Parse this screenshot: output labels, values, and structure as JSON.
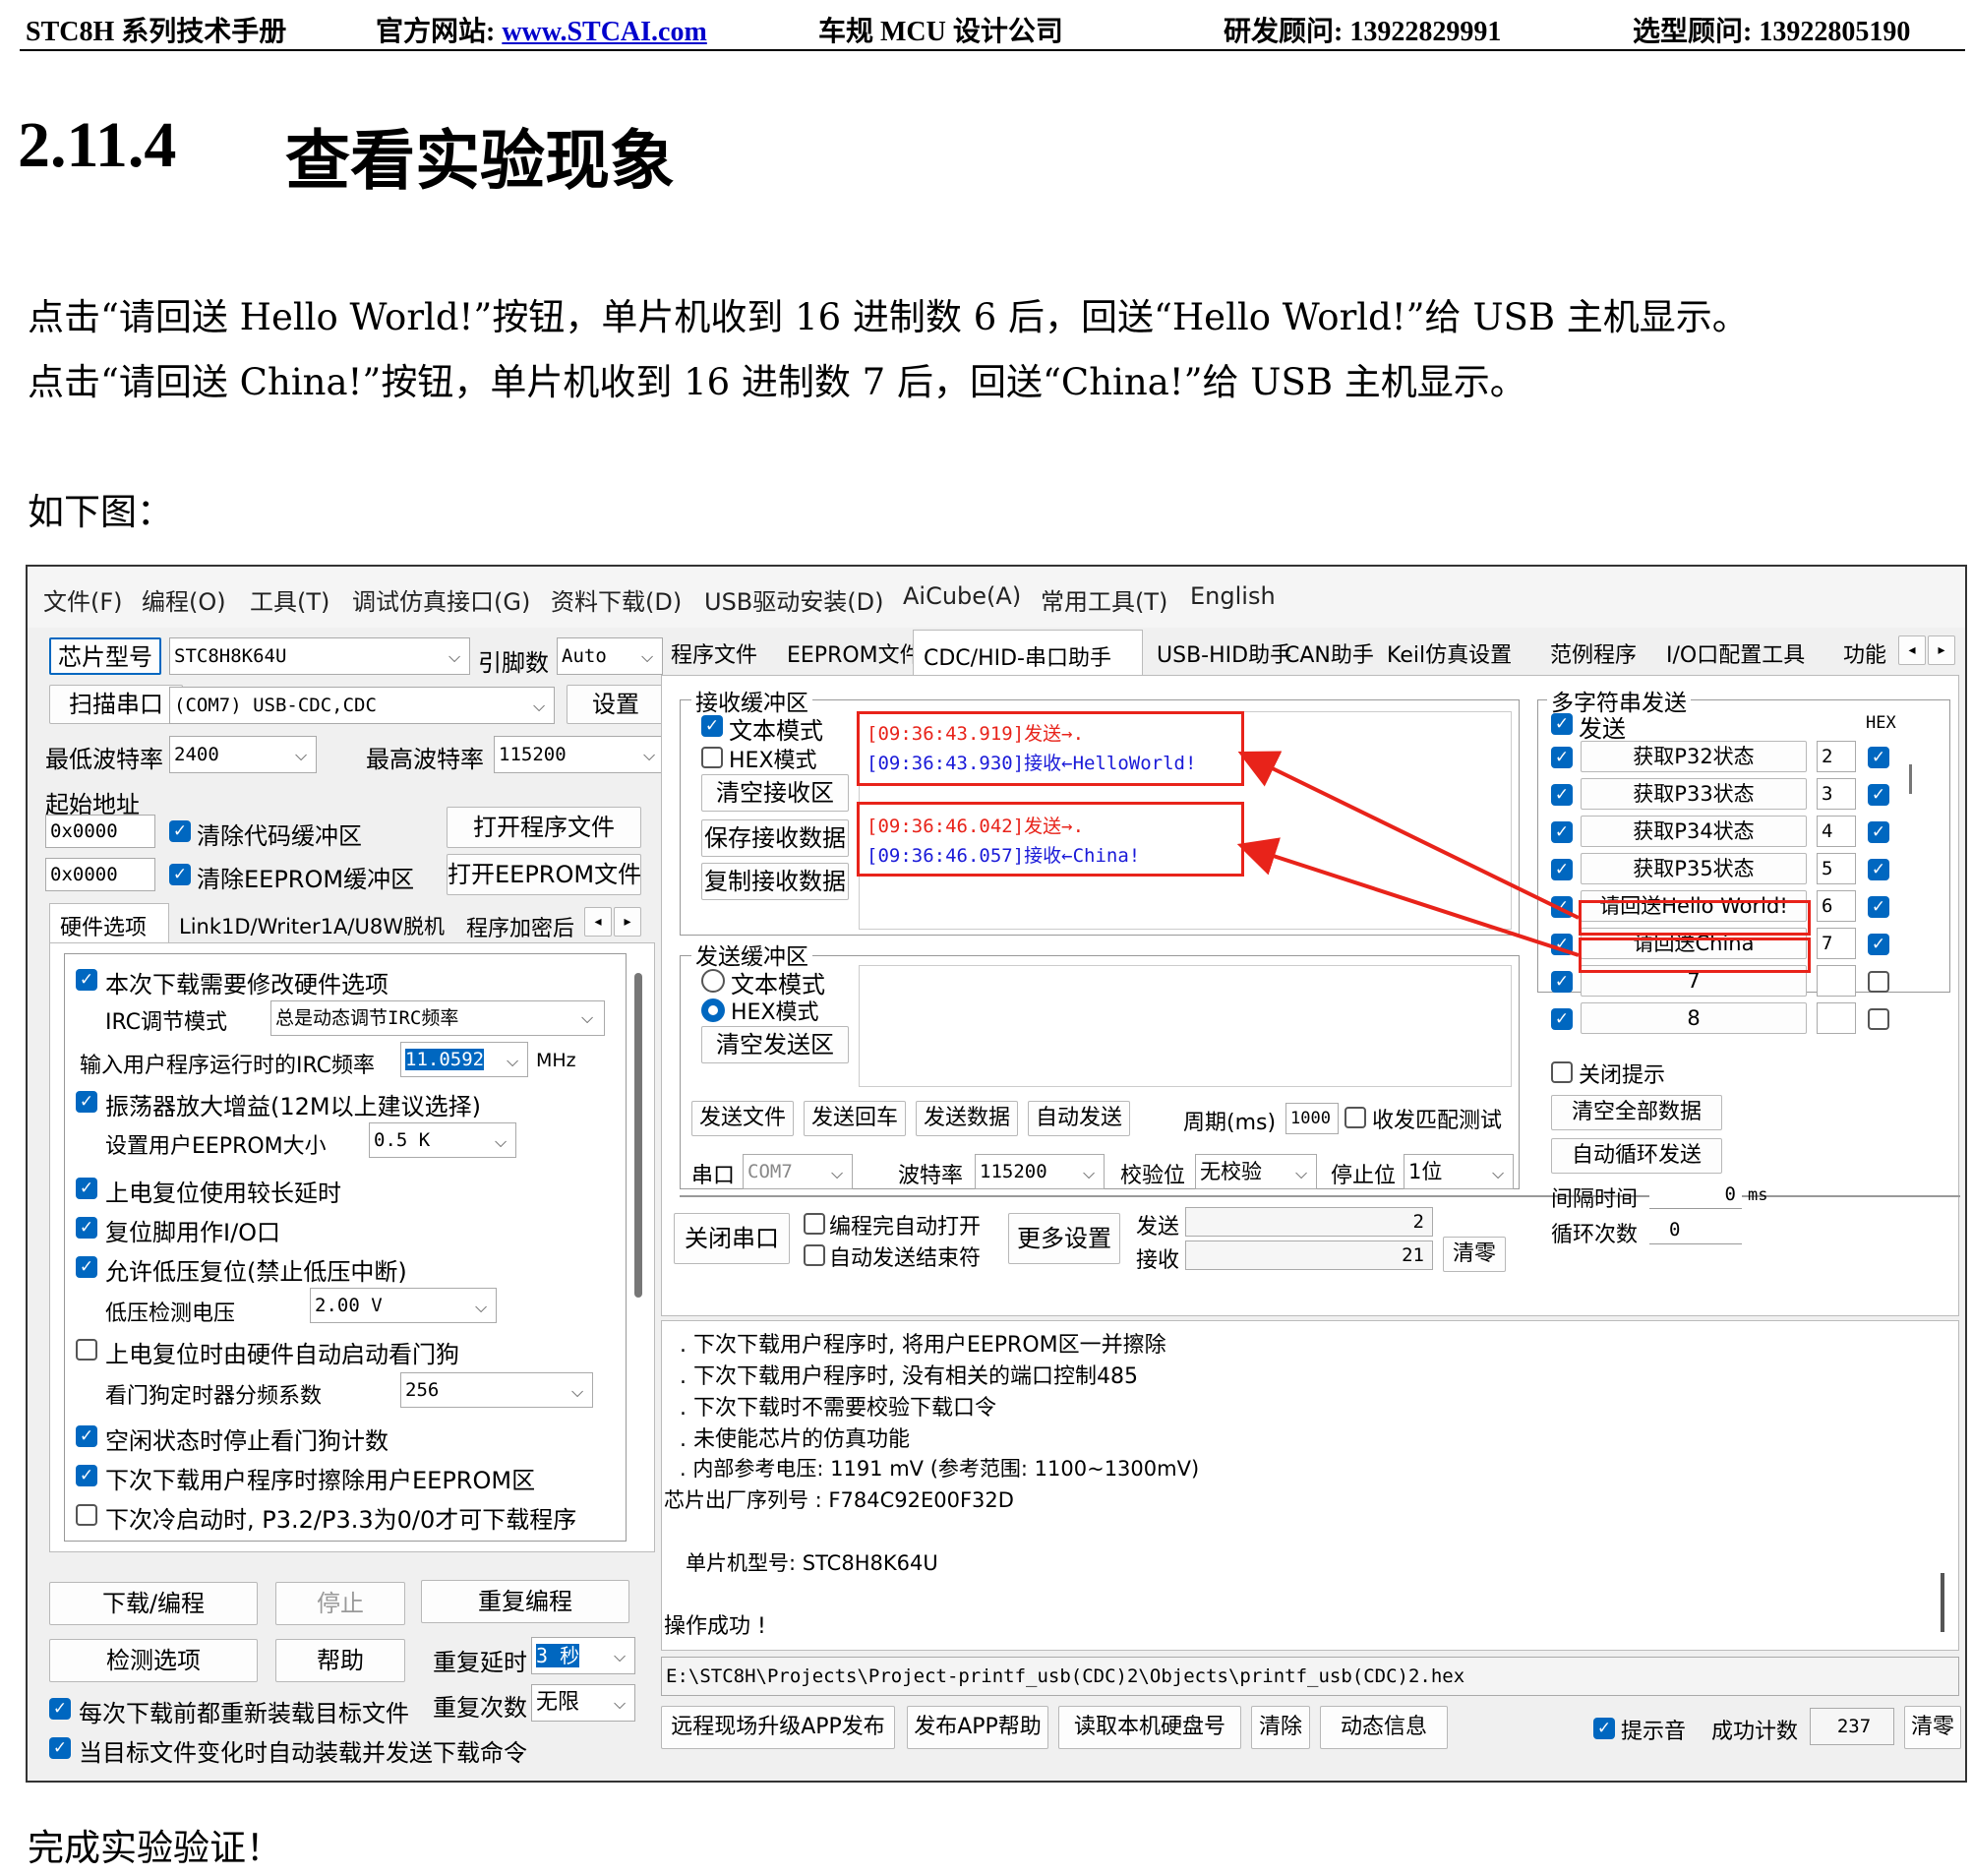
{
  "header": {
    "manual": "STC8H 系列技术手册",
    "site_label": "官方网站: ",
    "site_link": "www.STCAI.com",
    "company": "车规 MCU 设计公司",
    "rd": "研发顾问: 13922829991",
    "sel": "选型顾问: 13922805190"
  },
  "section": {
    "number": "2.11.4",
    "title": "查看实验现象"
  },
  "paragraphs": {
    "p1": "点击“请回送 Hello World!”按钮，单片机收到 16 进制数 6 后，回送“Hello World!”给 USB 主机显示。",
    "p2": "点击“请回送 China!”按钮，单片机收到 16 进制数 7 后，回送“China!”给 USB 主机显示。",
    "p3": "如下图：",
    "p4": "完成实验验证！"
  },
  "menu": [
    "文件(F)",
    "编程(O)",
    "工具(T)",
    "调试仿真接口(G)",
    "资料下载(D)",
    "USB驱动安装(D)",
    "AiCube(A)",
    "常用工具(T)",
    "English"
  ],
  "left": {
    "chip_btn": "芯片型号",
    "chip": "STC8H8K64U",
    "pin_lbl": "引脚数",
    "pin": "Auto",
    "scan_btn": "扫描串口",
    "port": "(COM7) USB-CDC,CDC",
    "settings_btn": "设置",
    "min_baud_lbl": "最低波特率",
    "min_baud": "2400",
    "max_baud_lbl": "最高波特率",
    "max_baud": "115200",
    "start_addr_lbl": "起始地址",
    "addr1": "0x0000",
    "clear_code": "清除代码缓冲区",
    "open_prog": "打开程序文件",
    "addr2": "0x0000",
    "clear_eeprom": "清除EEPROM缓冲区",
    "open_eeprom": "打开EEPROM文件",
    "tabs": [
      "硬件选项",
      "Link1D/Writer1A/U8W脱机",
      "程序加密后"
    ],
    "hw": {
      "o1": "本次下载需要修改硬件选项",
      "irc_mode_lbl": "IRC调节模式",
      "irc_mode": "总是动态调节IRC频率",
      "irc_freq_lbl": "输入用户程序运行时的IRC频率",
      "irc_freq": "11.0592",
      "mhz": "MHz",
      "o2": "振荡器放大增益(12M以上建议选择)",
      "eeprom_lbl": "设置用户EEPROM大小",
      "eeprom": "0.5 K",
      "o3": "上电复位使用较长延时",
      "o4": "复位脚用作I/O口",
      "o5": "允许低压复位(禁止低压中断)",
      "lvd_lbl": "低压检测电压",
      "lvd": "2.00 V",
      "o6": "上电复位时由硬件自动启动看门狗",
      "wdt_lbl": "看门狗定时器分频系数",
      "wdt": "256",
      "o7": "空闲状态时停止看门狗计数",
      "o8": "下次下载用户程序时擦除用户EEPROM区",
      "o9": "下次冷启动时, P3.2/P3.3为0/0才可下载程序"
    },
    "download_btn": "下载/编程",
    "stop_btn": "停止",
    "reprog_btn": "重复编程",
    "check_btn": "检测选项",
    "help_btn": "帮助",
    "delay_lbl": "重复延时",
    "delay": "3 秒",
    "count_lbl": "重复次数",
    "count": "无限",
    "reload": "每次下载前都重新装载目标文件",
    "autoload": "当目标文件变化时自动装载并发送下载命令"
  },
  "right_tabs": [
    "程序文件",
    "EEPROM文件",
    "CDC/HID-串口助手",
    "USB-HID助手",
    "CAN助手",
    "Keil仿真设置",
    "范例程序",
    "I/O口配置工具",
    "功能"
  ],
  "cdc": {
    "rx_title": "接收缓冲区",
    "text_mode": "文本模式",
    "hex_mode": "HEX模式",
    "clear_rx": "清空接收区",
    "save_rx": "保存接收数据",
    "copy_rx": "复制接收数据",
    "log": [
      {
        "t": "[09:36:43.919]发送→.",
        "c": "#e8231a"
      },
      {
        "t": "[09:36:43.930]接收←HelloWorld!",
        "c": "#1a1ad8"
      },
      {
        "t": "[09:36:46.042]发送→.",
        "c": "#e8231a"
      },
      {
        "t": "[09:36:46.057]接收←China!",
        "c": "#1a1ad8"
      }
    ],
    "tx_title": "发送缓冲区",
    "tx_text_mode": "文本模式",
    "tx_hex_mode": "HEX模式",
    "clear_tx": "清空发送区",
    "send_file": "发送文件",
    "send_cr": "发送回车",
    "send_data": "发送数据",
    "auto_send": "自动发送",
    "period_lbl": "周期(ms)",
    "period": "1000",
    "match_test": "收发匹配测试",
    "port_lbl": "串口",
    "port": "COM7",
    "baud_lbl": "波特率",
    "baud": "115200",
    "parity_lbl": "校验位",
    "parity": "无校验",
    "stop_lbl": "停止位",
    "stop": "1位",
    "close_port": "关闭串口",
    "auto_open": "编程完自动打开",
    "auto_end": "自动发送结束符",
    "more": "更多设置",
    "sent_lbl": "发送",
    "sent": "2",
    "recv_lbl": "接收",
    "recv": "21",
    "clear_cnt": "清零"
  },
  "multi": {
    "title": "多字符串发送",
    "send": "发送",
    "hex": "HEX",
    "rows": [
      {
        "label": "获取P32状态",
        "val": "2"
      },
      {
        "label": "获取P33状态",
        "val": "3"
      },
      {
        "label": "获取P34状态",
        "val": "4"
      },
      {
        "label": "获取P35状态",
        "val": "5"
      },
      {
        "label": "请回送Hello World!",
        "val": "6"
      },
      {
        "label": "请回送China",
        "val": "7"
      },
      {
        "label": "7",
        "val": ""
      },
      {
        "label": "8",
        "val": ""
      }
    ],
    "close_hint": "关闭提示",
    "clear_all": "清空全部数据",
    "auto_loop": "自动循环发送",
    "interval_lbl": "间隔时间",
    "interval": "0",
    "ms": "ms",
    "loop_lbl": "循环次数",
    "loop": "0"
  },
  "output": {
    "lines": [
      ". 下次下载用户程序时, 将用户EEPROM区一并擦除",
      ". 下次下载用户程序时, 没有相关的端口控制485",
      ". 下次下载时不需要校验下载口令",
      ". 未使能芯片的仿真功能",
      ". 内部参考电压: 1191 mV (参考范围: 1100~1300mV)",
      "芯片出厂序列号 : F784C92E00F32D",
      "单片机型号: STC8H8K64U",
      "操作成功 !"
    ],
    "path": "E:\\STC8H\\Projects\\Project-printf_usb(CDC)2\\Objects\\printf_usb(CDC)2.hex"
  },
  "bottom": {
    "b1": "远程现场升级APP发布",
    "b2": "发布APP帮助",
    "b3": "读取本机硬盘号",
    "b4": "清除",
    "b5": "动态信息",
    "beep": "提示音",
    "succ_lbl": "成功计数",
    "succ": "237",
    "clear": "清零"
  }
}
